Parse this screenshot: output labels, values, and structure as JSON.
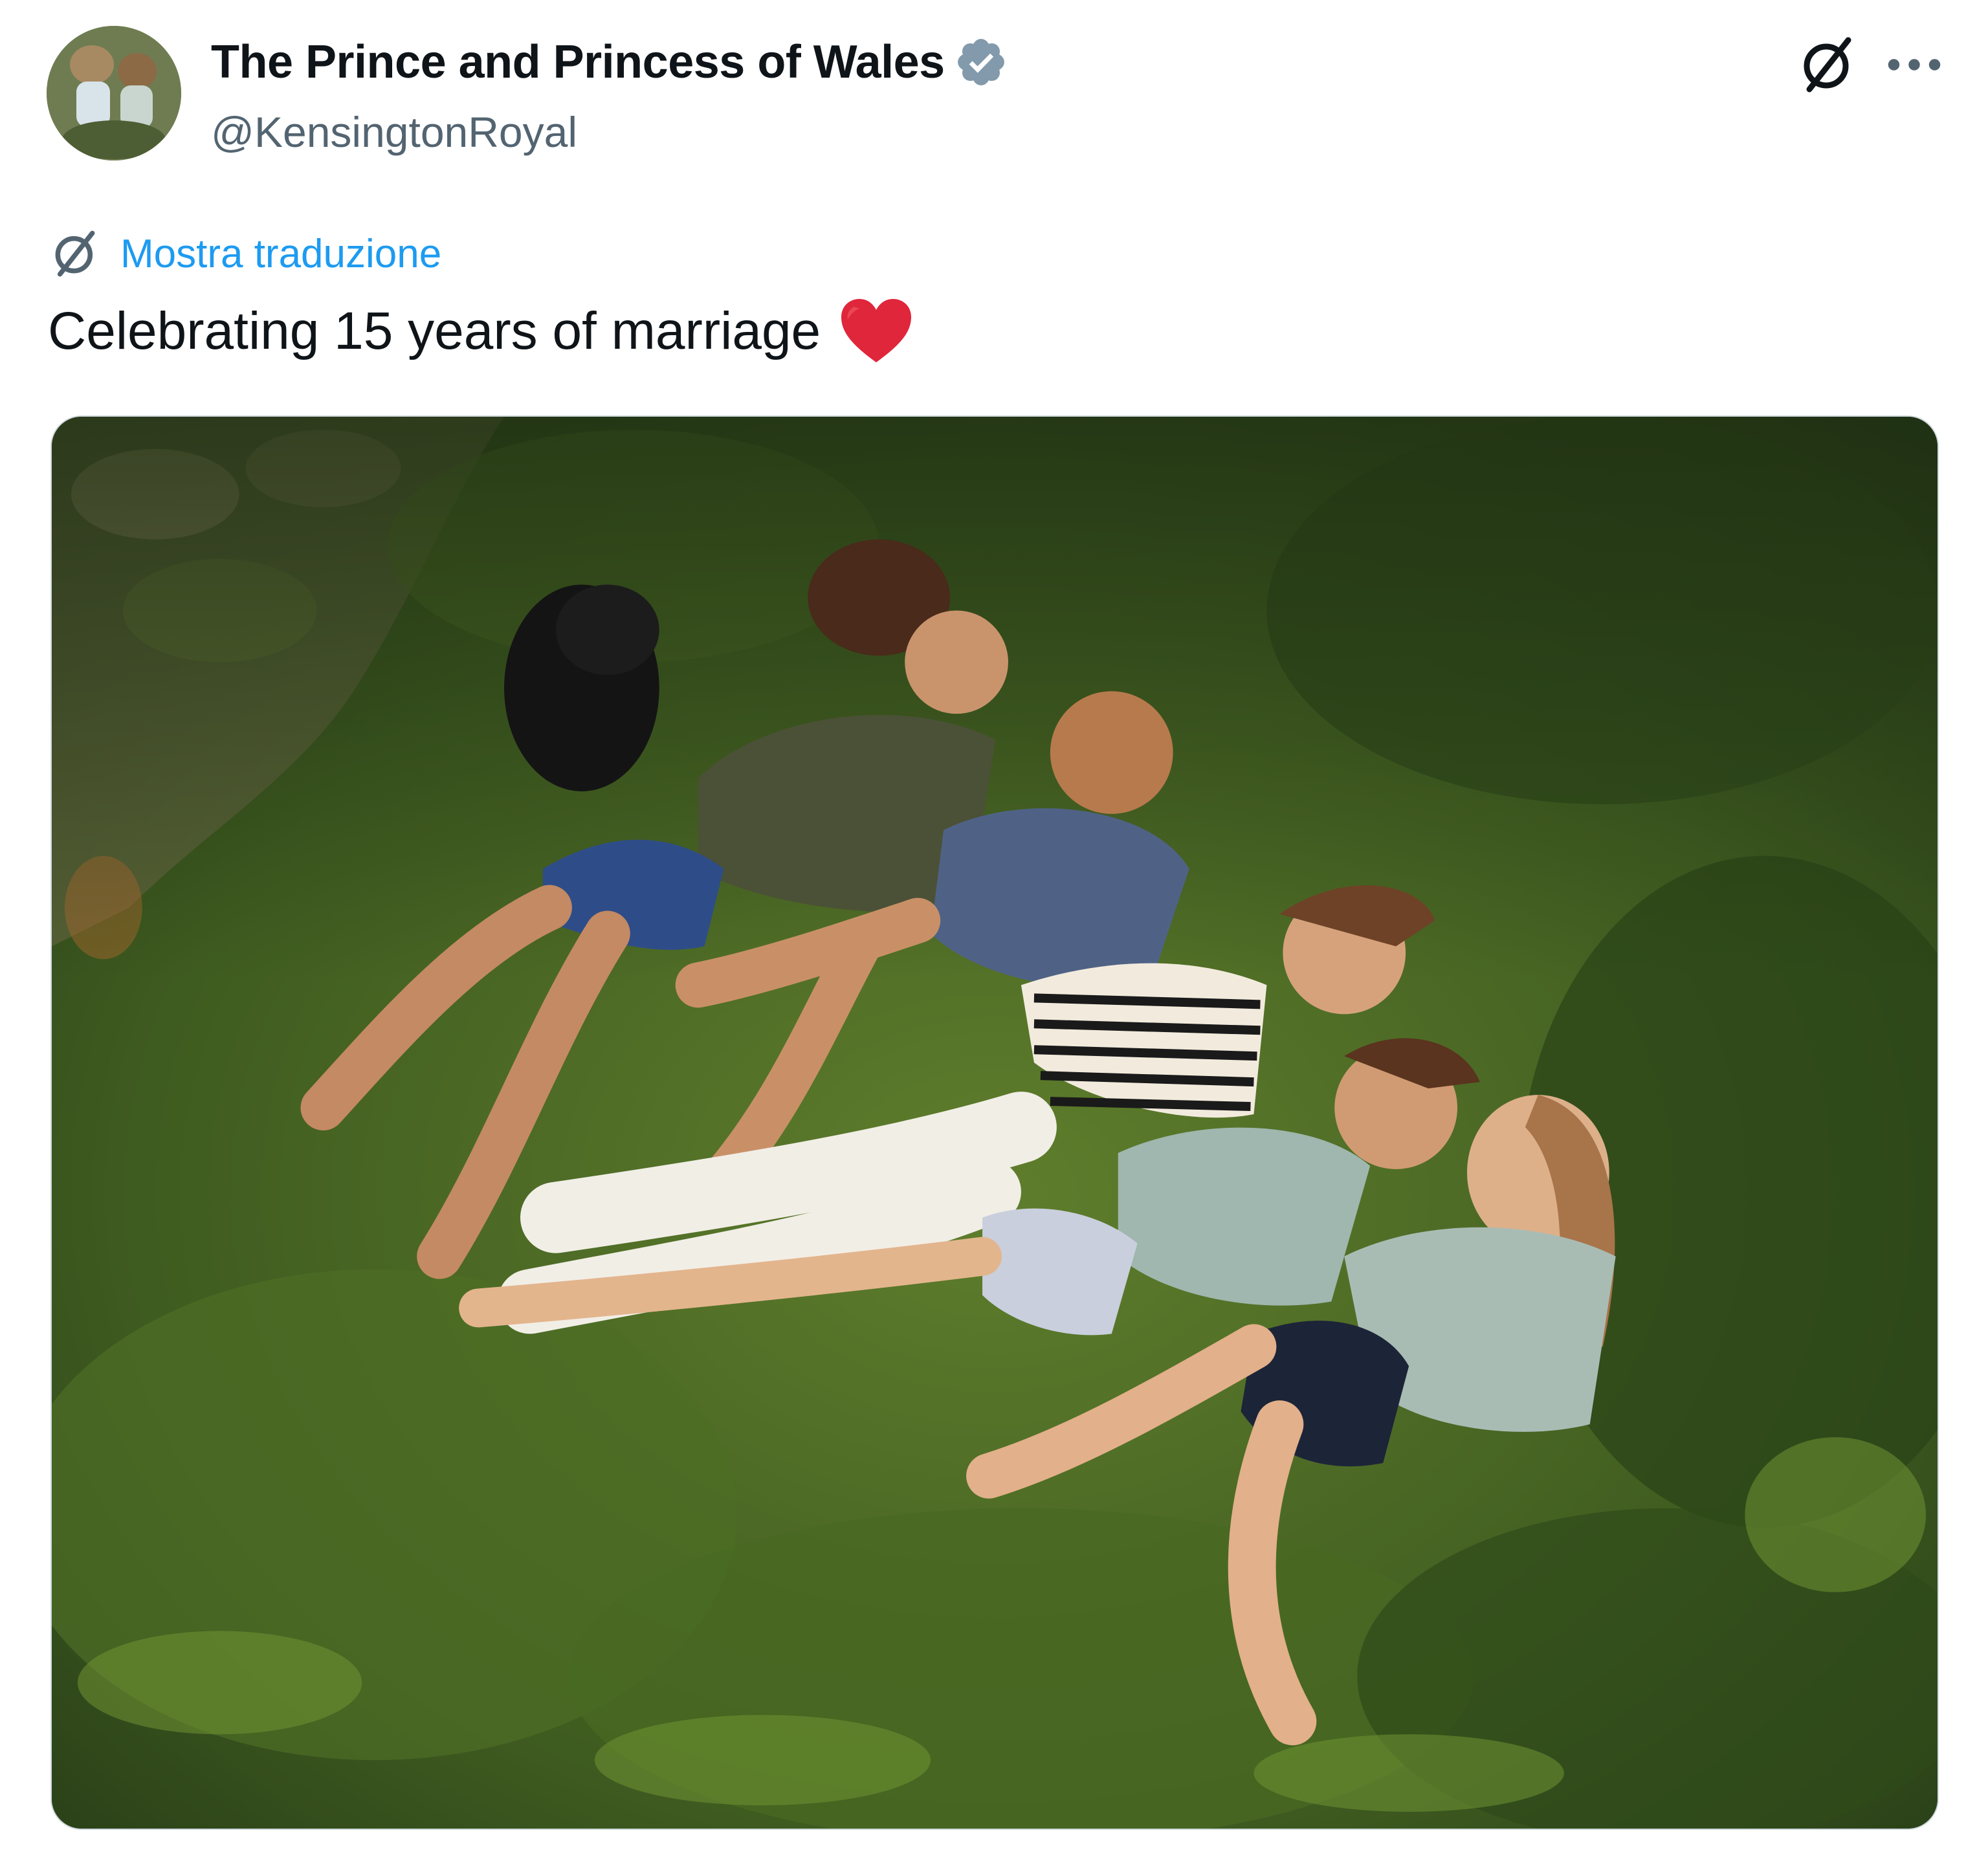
{
  "author": {
    "display_name": "The Prince and Princess of Wales",
    "handle": "@KensingtonRoyal",
    "verified": true,
    "verified_color": "#829aab"
  },
  "translate": {
    "label": "Mostra traduzione",
    "color": "#1d9bf0"
  },
  "post": {
    "text": "Celebrating 15 years of marriage",
    "emoji": "red-heart-icon"
  },
  "icons": {
    "grok": "grok-icon",
    "more": "more-icon",
    "translate": "grok-translate-icon"
  },
  "media": {
    "type": "photo",
    "subject": "family-on-grass"
  }
}
